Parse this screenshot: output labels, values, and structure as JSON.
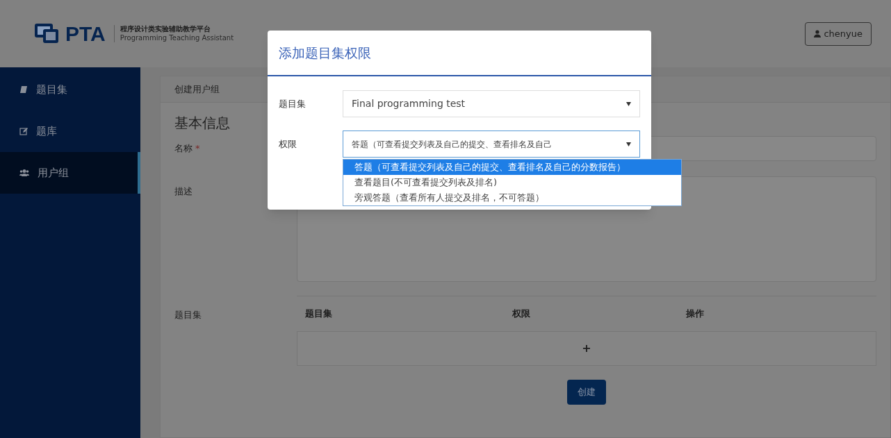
{
  "header": {
    "logo_text": "PTA",
    "logo_title": "程序设计类实验辅助教学平台",
    "logo_subtitle": "Programming Teaching Assistant",
    "user": "chenyue"
  },
  "sidebar": {
    "items": [
      {
        "label": "题目集",
        "kind": "book",
        "selected": false
      },
      {
        "label": "题库",
        "kind": "edit",
        "selected": false
      },
      {
        "label": "用户组",
        "kind": "users",
        "selected": true
      }
    ]
  },
  "breadcrumb": "创建用户组",
  "form": {
    "section_title": "基本信息",
    "name_label": "名称",
    "required_mark": "*",
    "description_label": "描述",
    "problem_sets_label": "题目集",
    "table": {
      "columns": [
        "题目集",
        "权限",
        "操作"
      ],
      "add_button": "+"
    },
    "submit": "创建"
  },
  "dialog": {
    "title": "添加题目集权限",
    "fields": [
      {
        "label": "题目集",
        "value": "Final programming test",
        "focused": false
      },
      {
        "label": "权限",
        "value": "答题（可查看提交列表及自己的提交、查看排名及自己",
        "focused": true
      }
    ],
    "dropdown_options": [
      {
        "label": "答题（可查看提交列表及自己的提交、查看排名及自己的分数报告）",
        "selected": true
      },
      {
        "label": "查看题目(不可查看提交列表及排名)",
        "selected": false
      },
      {
        "label": "旁观答题（查看所有人提交及排名，不可答题）",
        "selected": false
      }
    ]
  }
}
